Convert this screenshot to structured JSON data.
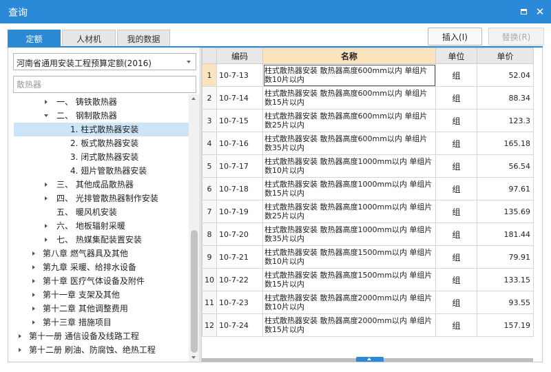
{
  "window": {
    "title": "查询"
  },
  "tabs": [
    {
      "label": "定额",
      "active": true
    },
    {
      "label": "人材机",
      "active": false
    },
    {
      "label": "我的数据",
      "active": false
    }
  ],
  "buttons": {
    "insert": "插入(I)",
    "replace": "替换(R)"
  },
  "left": {
    "quota_book": "河南省通用安装工程预算定额(2016)",
    "search_placeholder": "散热器",
    "tree": [
      {
        "label": "一、 铸铁散热器",
        "expanded": false
      },
      {
        "label": "二、 钢制散热器",
        "expanded": true
      },
      {
        "label": "1. 柱式散热器安装",
        "selected": true
      },
      {
        "label": "2. 板式散热器安装"
      },
      {
        "label": "3. 闭式散热器安装"
      },
      {
        "label": "4. 翅片管散热器安装"
      },
      {
        "label": "三、 其他成品散热器",
        "expanded": false
      },
      {
        "label": "四、 光排管散热器制作安装",
        "expanded": false
      },
      {
        "label": "五、 暖风机安装"
      },
      {
        "label": "六、 地板辐射采暖",
        "expanded": false
      },
      {
        "label": "七、 热媒集配装置安装",
        "expanded": false
      },
      {
        "label": "第八章 燃气器具及其他",
        "expanded": false
      },
      {
        "label": "第九章 采暖、给排水设备",
        "expanded": false
      },
      {
        "label": "第十章 医疗气体设备及附件",
        "expanded": false
      },
      {
        "label": "第十一章 支架及其他",
        "expanded": false
      },
      {
        "label": "第十二章 其他调整费用",
        "expanded": false
      },
      {
        "label": "第十三章 措施项目",
        "expanded": false
      },
      {
        "label": "第十一册 通信设备及线路工程",
        "expanded": false
      },
      {
        "label": "第十二册 刷油、防腐蚀、绝热工程",
        "expanded": false
      }
    ]
  },
  "table": {
    "headers": {
      "code": "编码",
      "name": "名称",
      "unit": "单位",
      "price": "单价"
    },
    "rows": [
      {
        "idx": "1",
        "code": "10-7-13",
        "name": "柱式散热器安装 散热器高度600mm以内 单组片数10片以内",
        "unit": "组",
        "price": "52.04",
        "selected": true
      },
      {
        "idx": "2",
        "code": "10-7-14",
        "name": "柱式散热器安装 散热器高度600mm以内 单组片数15片以内",
        "unit": "组",
        "price": "88.34"
      },
      {
        "idx": "3",
        "code": "10-7-15",
        "name": "柱式散热器安装 散热器高度600mm以内 单组片数25片以内",
        "unit": "组",
        "price": "123.3"
      },
      {
        "idx": "4",
        "code": "10-7-16",
        "name": "柱式散热器安装 散热器高度600mm以内 单组片数35片以内",
        "unit": "组",
        "price": "165.18"
      },
      {
        "idx": "5",
        "code": "10-7-17",
        "name": "柱式散热器安装 散热器高度1000mm以内 单组片数10片以内",
        "unit": "组",
        "price": "56.54"
      },
      {
        "idx": "6",
        "code": "10-7-18",
        "name": "柱式散热器安装 散热器高度1000mm以内 单组片数15片以内",
        "unit": "组",
        "price": "97.61"
      },
      {
        "idx": "7",
        "code": "10-7-19",
        "name": "柱式散热器安装 散热器高度1000mm以内 单组片数25片以内",
        "unit": "组",
        "price": "135.69"
      },
      {
        "idx": "8",
        "code": "10-7-20",
        "name": "柱式散热器安装 散热器高度1000mm以内 单组片数35片以内",
        "unit": "组",
        "price": "181.44"
      },
      {
        "idx": "9",
        "code": "10-7-21",
        "name": "柱式散热器安装 散热器高度1500mm以内 单组片数10片以内",
        "unit": "组",
        "price": "79.91"
      },
      {
        "idx": "10",
        "code": "10-7-22",
        "name": "柱式散热器安装 散热器高度1500mm以内 单组片数15片以内",
        "unit": "组",
        "price": "133.15"
      },
      {
        "idx": "11",
        "code": "10-7-23",
        "name": "柱式散热器安装 散热器高度2000mm以内 单组片数10片以内",
        "unit": "组",
        "price": "93.55"
      },
      {
        "idx": "12",
        "code": "10-7-24",
        "name": "柱式散热器安装 散热器高度2000mm以内 单组片数15片以内",
        "unit": "组",
        "price": "157.19"
      }
    ]
  }
}
